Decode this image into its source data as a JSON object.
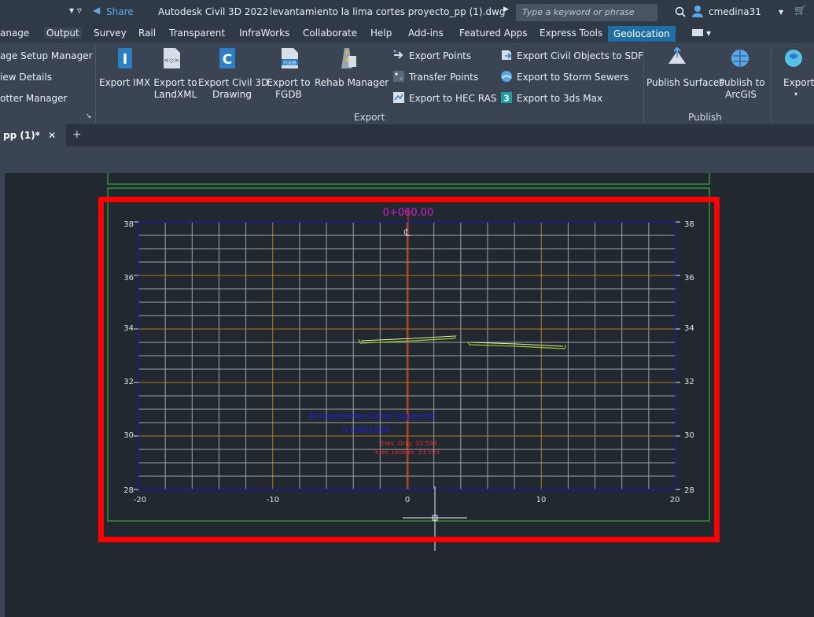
{
  "titlebar": {
    "share": "Share",
    "app_title": "Autodesk Civil 3D 2022",
    "file_name": "levantamiento la lima cortes proyecto_pp (1).dwg",
    "search_placeholder": "Type a keyword or phrase",
    "user": "cmedina31"
  },
  "ribbon_tabs": [
    "anage",
    "Output",
    "Survey",
    "Rail",
    "Transparent",
    "InfraWorks",
    "Collaborate",
    "Help",
    "Add-ins",
    "Featured Apps",
    "Express Tools",
    "Geolocation"
  ],
  "ribbon": {
    "plot_items": [
      "age Setup Manager",
      "iew Details",
      "otter Manager"
    ],
    "export_imx": "Export IMX",
    "export_landxml": [
      "Export to",
      "LandXML"
    ],
    "export_civil3d": [
      "Export Civil 3D",
      "Drawing"
    ],
    "export_fgdb": [
      "Export to",
      "FGDB"
    ],
    "rehab_manager": "Rehab Manager",
    "export_points": "Export Points",
    "transfer_points": "Transfer Points",
    "export_hec_ras": "Export to HEC RAS",
    "export_sdf": "Export Civil Objects to SDF",
    "export_storm": "Export to Storm Sewers",
    "export_3ds": "Export to 3ds Max",
    "group_export": "Export",
    "publish_surfaces": "Publish Surfaces",
    "publish_arcgis": [
      "Publish to",
      "ArcGIS"
    ],
    "group_publish": "Publish",
    "export_partial": "Export",
    "fgdb_icon_text": "FGDB"
  },
  "document_tab": {
    "label": "pp (1)*"
  },
  "section": {
    "station_title": "0+060.00",
    "centerline_symbol": "℄",
    "y_ticks": [
      "38",
      "36",
      "34",
      "32",
      "30",
      "28"
    ],
    "x_ticks": [
      "-20",
      "-10",
      "0",
      "10",
      "20"
    ],
    "label_line1": "Alineamiento Canal Izquierdo",
    "label_line2": "0+060.000",
    "elev_orig": "Elev. Orig: 33.593",
    "elev_diseno": "Elev. Diseño: 33.593"
  },
  "colors": {
    "highlight_frame": "#ff0000",
    "grid_major": "#b87a1e",
    "grid_minor": "#a0a4a8",
    "centerline": "#e03030",
    "station": "#d020d0",
    "viewport_border": "#34c934",
    "axis_frame": "#1a1a9a",
    "label_blue": "#2222cc",
    "ground_line": "#9ad02a"
  }
}
